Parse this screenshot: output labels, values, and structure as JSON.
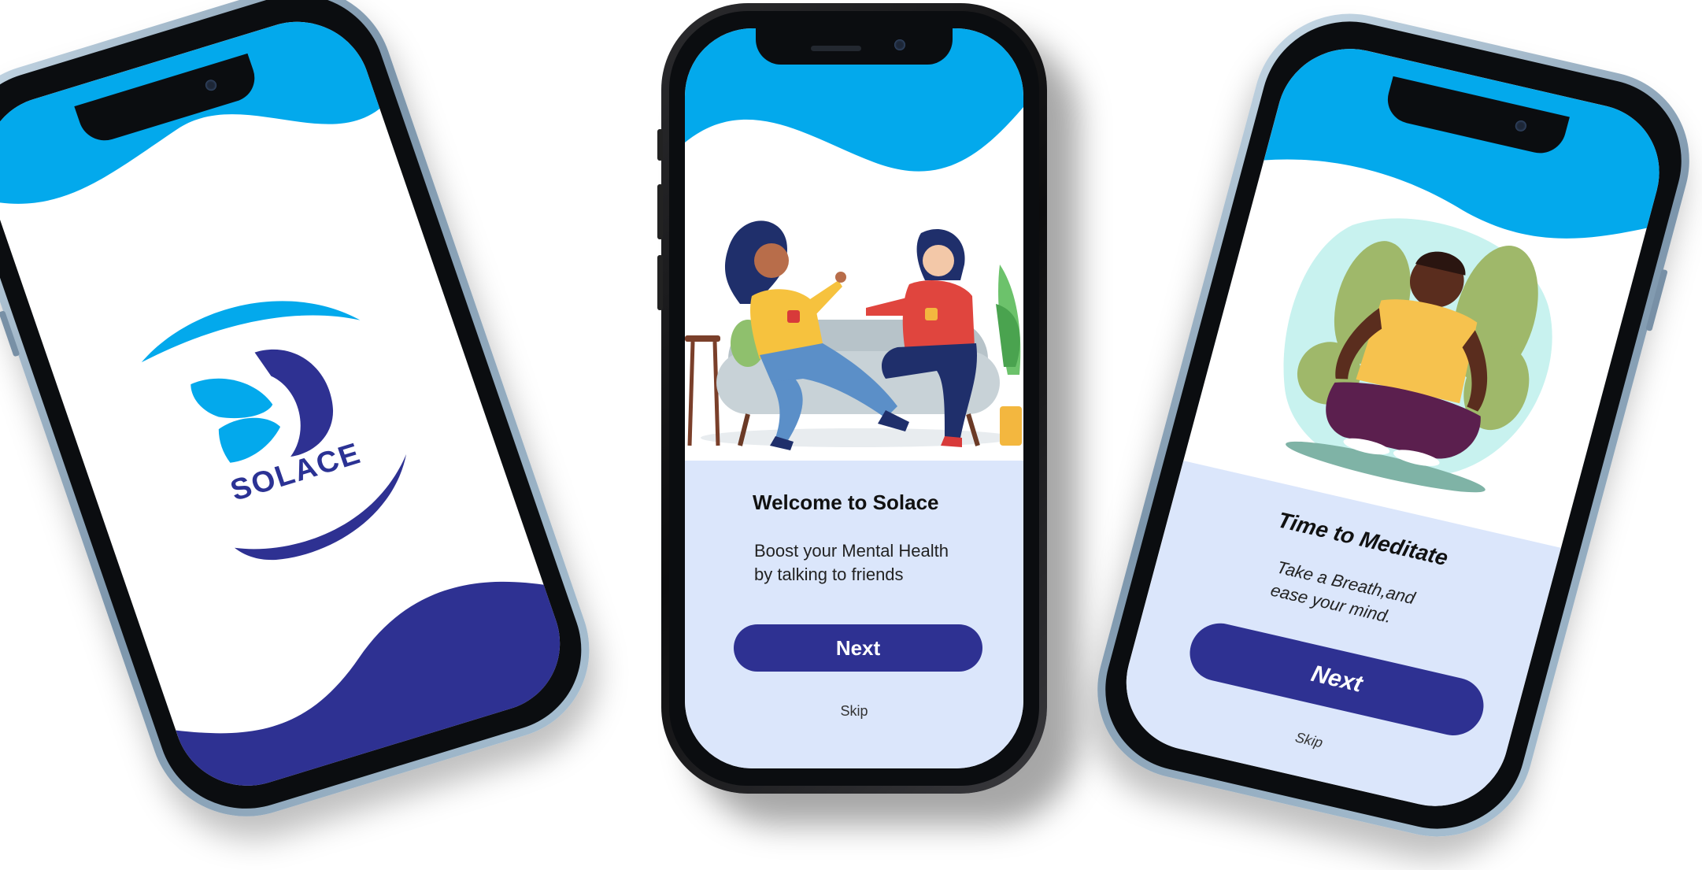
{
  "colors": {
    "sky_blue": "#03a9ec",
    "navy": "#2e3192",
    "panel": "#dbe6fb"
  },
  "splash": {
    "logo_text": "SOLACE",
    "logo_icon": "butterfly-face-icon"
  },
  "welcome": {
    "title": "Welcome to Solace",
    "subtitle_line1": "Boost your Mental Health",
    "subtitle_line2": "by talking to friends",
    "next_label": "Next",
    "skip_label": "Skip",
    "illustration": "friends-on-sofa-illustration"
  },
  "meditate": {
    "title": "Time to Meditate",
    "subtitle_line1": "Take a Breath,and",
    "subtitle_line2": "ease your mind.",
    "next_label": "Next",
    "skip_label": "Skip",
    "illustration": "meditating-man-illustration"
  }
}
